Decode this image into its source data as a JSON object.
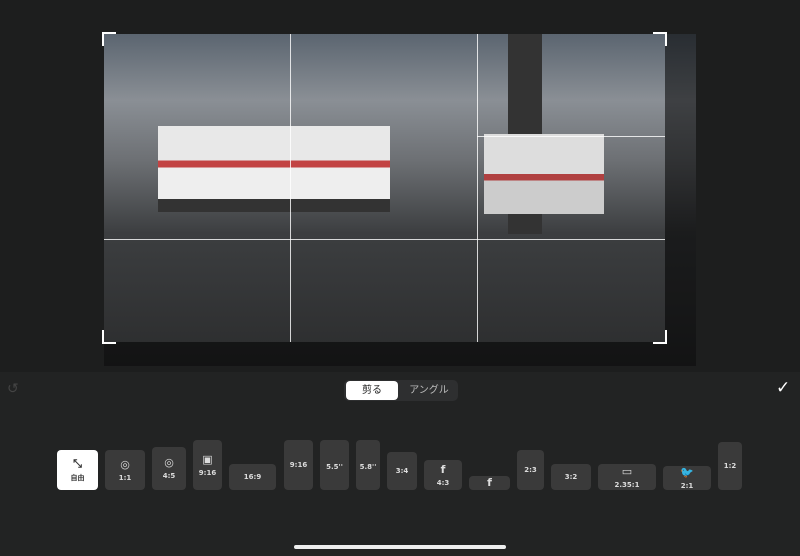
{
  "editor": {
    "tabs": [
      {
        "label": "剪る",
        "active": true
      },
      {
        "label": "アングル",
        "active": false
      }
    ],
    "undo_icon": "undo-icon",
    "confirm_icon": "checkmark-icon"
  },
  "ratios": [
    {
      "label": "自由",
      "icon": "free-crop-icon",
      "selected": true
    },
    {
      "label": "1:1",
      "icon": "instagram-icon"
    },
    {
      "label": "4:5",
      "icon": "instagram-icon"
    },
    {
      "label": "9:16",
      "icon": "reels-icon"
    },
    {
      "label": "16:9"
    },
    {
      "label": "9:16"
    },
    {
      "label": "5.5''",
      "icon": "apple-icon"
    },
    {
      "label": "5.8''",
      "icon": "apple-icon"
    },
    {
      "label": "3:4"
    },
    {
      "label": "4:3",
      "icon": "facebook-icon"
    },
    {
      "label": "",
      "icon": "facebook-icon"
    },
    {
      "label": "2:3"
    },
    {
      "label": "3:2"
    },
    {
      "label": "2.35:1",
      "icon": "film-icon"
    },
    {
      "label": "2:1",
      "icon": "twitter-icon"
    },
    {
      "label": "1:2"
    }
  ]
}
